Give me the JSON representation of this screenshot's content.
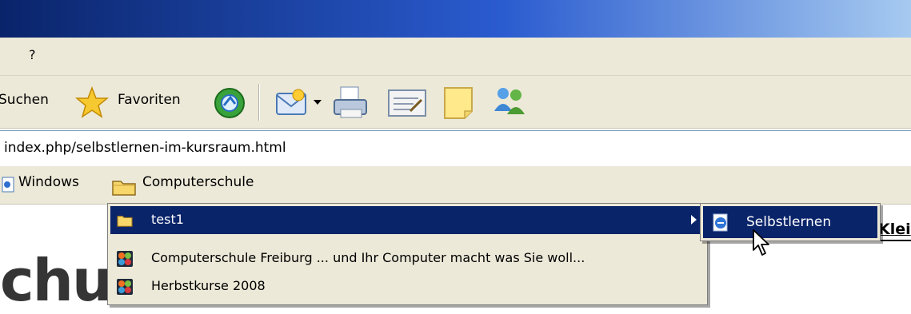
{
  "menubar": {
    "help_label": "?"
  },
  "toolbar": {
    "search_label": "Suchen",
    "favorites_label": "Favoriten",
    "icons": [
      "star-icon",
      "media-icon",
      "mail-icon",
      "print-icon",
      "edit-icon",
      "note-icon",
      "messenger-icon"
    ]
  },
  "address": {
    "url": "index.php/selbstlernen-im-kursraum.html"
  },
  "links": {
    "items": [
      {
        "label": "Windows"
      },
      {
        "label": "Computerschule"
      }
    ]
  },
  "menu": {
    "items": [
      {
        "label": "test1",
        "icon": "folder-icon",
        "selected": true,
        "has_submenu": true
      },
      {
        "label": "Computerschule Freiburg ... und Ihr Computer macht was Sie woll...",
        "icon": "joomla-icon"
      },
      {
        "label": "Herbstkurse 2008",
        "icon": "joomla-icon"
      }
    ],
    "submenu": {
      "items": [
        {
          "label": "Selbstlernen",
          "icon": "ie-page-icon"
        }
      ]
    }
  },
  "page": {
    "logo_text": "chu",
    "right_text": "Klei"
  },
  "colors": {
    "selection": "#0a246a",
    "chrome": "#ece9d8",
    "title_start": "#0a246a",
    "title_end": "#a6caf0"
  }
}
